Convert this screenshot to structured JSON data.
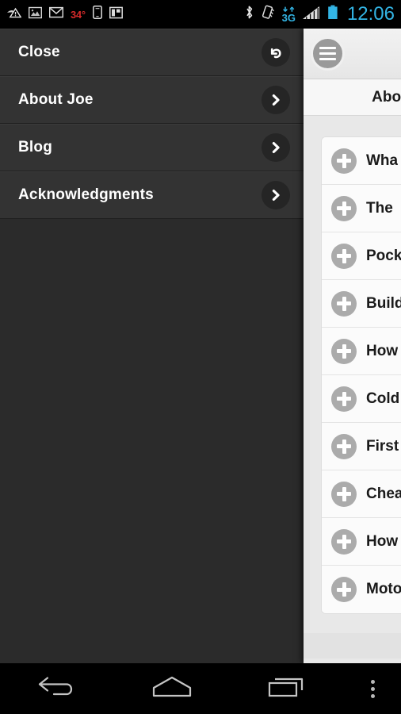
{
  "status_bar": {
    "icons_left": [
      {
        "name": "sync-problem-icon",
        "glyph": "sync-warning"
      },
      {
        "name": "gallery-icon",
        "glyph": "photo"
      },
      {
        "name": "gmail-icon",
        "glyph": "envelope"
      },
      {
        "name": "temperature-indicator",
        "text": "34°"
      },
      {
        "name": "phone-icon",
        "glyph": "phone"
      },
      {
        "name": "app-window-icon",
        "glyph": "panel"
      }
    ],
    "icons_right": [
      {
        "name": "bluetooth-icon",
        "glyph": "bluetooth"
      },
      {
        "name": "vibrate-mode-icon",
        "glyph": "vibrate"
      },
      {
        "name": "network-type-icon",
        "text": "3G"
      },
      {
        "name": "signal-strength-icon",
        "glyph": "bars"
      },
      {
        "name": "battery-icon",
        "glyph": "battery"
      }
    ],
    "clock": "12:06",
    "accent_color": "#33b5e5",
    "temp_color": "#d42a2a"
  },
  "drawer": {
    "background": "#2b2b2b",
    "row_background": "#333333",
    "items": [
      {
        "label": "Close",
        "icon": "undo-arrow-icon"
      },
      {
        "label": "About Joe",
        "icon": "chevron-right-icon"
      },
      {
        "label": "Blog",
        "icon": "chevron-right-icon"
      },
      {
        "label": "Acknowledgments",
        "icon": "chevron-right-icon"
      }
    ]
  },
  "content": {
    "menu_button_icon": "hamburger-menu-icon",
    "header_title": "About",
    "list_items": [
      {
        "label": "Wha",
        "icon": "plus-circle-icon"
      },
      {
        "label": "The",
        "icon": "plus-circle-icon"
      },
      {
        "label": "Pock",
        "icon": "plus-circle-icon"
      },
      {
        "label": "Build",
        "icon": "plus-circle-icon"
      },
      {
        "label": "How",
        "icon": "plus-circle-icon"
      },
      {
        "label": "Cold",
        "icon": "plus-circle-icon"
      },
      {
        "label": "First",
        "icon": "plus-circle-icon"
      },
      {
        "label": "Chea",
        "icon": "plus-circle-icon"
      },
      {
        "label": "How",
        "icon": "plus-circle-icon"
      },
      {
        "label": "Moto",
        "icon": "plus-circle-icon"
      }
    ]
  },
  "nav_bar": {
    "buttons": [
      {
        "name": "back-button",
        "icon": "back-arrow-icon"
      },
      {
        "name": "home-button",
        "icon": "home-icon"
      },
      {
        "name": "recents-button",
        "icon": "recents-icon"
      },
      {
        "name": "overflow-menu-button",
        "icon": "overflow-dots-icon"
      }
    ]
  }
}
